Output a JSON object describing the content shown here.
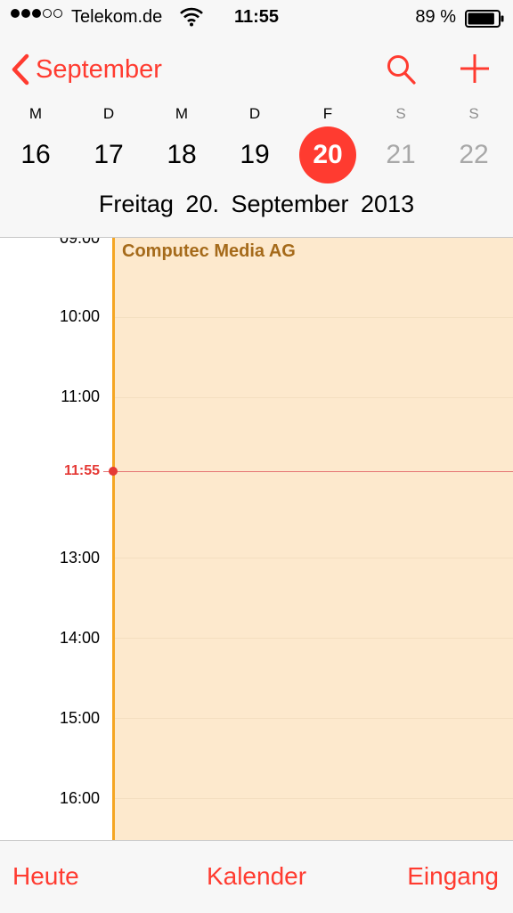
{
  "status_bar": {
    "signal_dots": [
      true,
      true,
      true,
      false,
      false
    ],
    "carrier": "Telekom.de",
    "time": "11:55",
    "battery_percent": "89 %",
    "battery_level": 0.89
  },
  "nav": {
    "back_label": "September",
    "search_icon": "magnifier-icon",
    "add_icon": "plus-icon"
  },
  "week": {
    "weekday_letters": [
      "M",
      "D",
      "M",
      "D",
      "F",
      "S",
      "S"
    ],
    "days": [
      "16",
      "17",
      "18",
      "19",
      "20",
      "21",
      "22"
    ],
    "selected_index": 4,
    "weekend_indices": [
      5,
      6
    ]
  },
  "date_title": "Freitag  20. September 2013",
  "timeline": {
    "hours": [
      "09:00",
      "10:00",
      "11:00",
      "13:00",
      "14:00",
      "15:00",
      "16:00"
    ],
    "current_time": "11:55"
  },
  "event": {
    "title": "Computec Media AG"
  },
  "tabs": {
    "today": "Heute",
    "calendars": "Kalender",
    "inbox": "Eingang"
  },
  "colors": {
    "accent": "#ff3b30",
    "event_bg": "#fde9cd",
    "event_bar": "#f5a623",
    "event_text": "#a56a1a"
  }
}
